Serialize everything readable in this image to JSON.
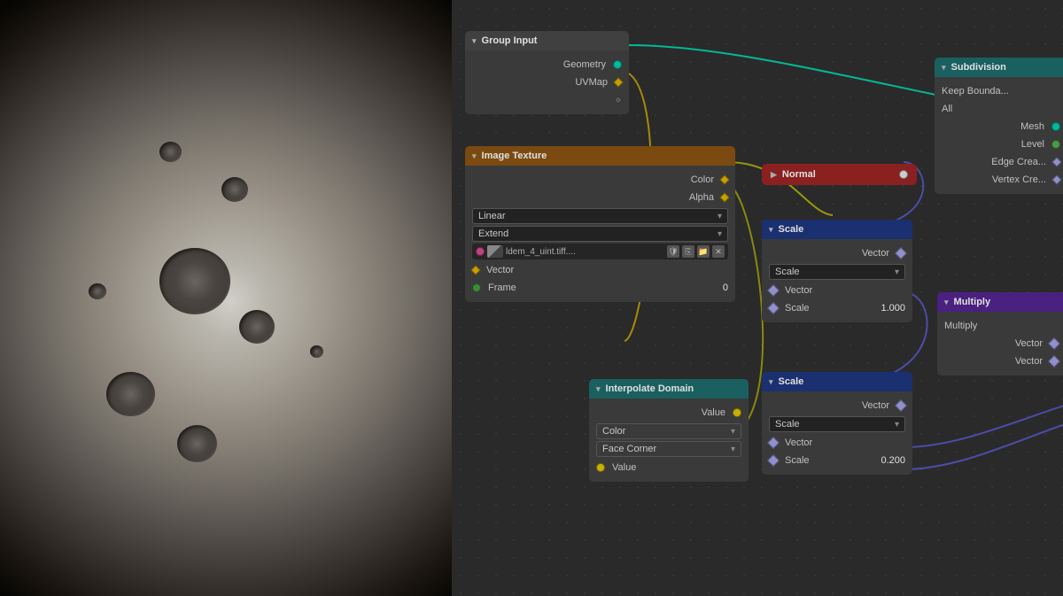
{
  "viewport": {
    "label": "3D Viewport"
  },
  "nodes": {
    "groupInput": {
      "title": "Group Input",
      "sockets": [
        {
          "label": "Geometry",
          "type": "teal"
        },
        {
          "label": "UVMap",
          "type": "yellow"
        },
        {
          "label": "",
          "type": "gray"
        }
      ]
    },
    "imageTexture": {
      "title": "Image Texture",
      "colorLabel": "Color",
      "alphaLabel": "Alpha",
      "interpolation": "Linear",
      "extension": "Extend",
      "filename": "ldem_4_uint.tiff....",
      "vectorLabel": "Vector",
      "frameLabel": "Frame",
      "frameValue": "0"
    },
    "normal": {
      "title": "Normal"
    },
    "scale1": {
      "title": "Scale",
      "vectorLabel": "Vector",
      "scaleMode": "Scale",
      "scaleVectorLabel": "Vector",
      "scaleScaleLabel": "Scale",
      "scaleValue": "1.000"
    },
    "scale2": {
      "title": "Scale",
      "vectorLabel": "Vector",
      "scaleMode": "Scale",
      "scaleVectorLabel": "Vector",
      "scaleScaleLabel": "Scale",
      "scaleValue": "0.200"
    },
    "interpolateDomain": {
      "title": "Interpolate Domain",
      "valueLabel": "Value",
      "colorLabel": "Color",
      "facecornerLabel": "Face Corner",
      "valueOutLabel": "Value"
    },
    "subdivision": {
      "title": "Subdivision",
      "keepBoundary": "Keep Bounda...",
      "all": "All",
      "mesh": "Mesh",
      "level": "Level",
      "edgeCrease": "Edge Crea...",
      "vertexCrease": "Vertex Cre..."
    },
    "multiply": {
      "title": "Multiply",
      "multiply": "Multiply",
      "vector1": "Vector",
      "vector2": "Vector"
    }
  }
}
